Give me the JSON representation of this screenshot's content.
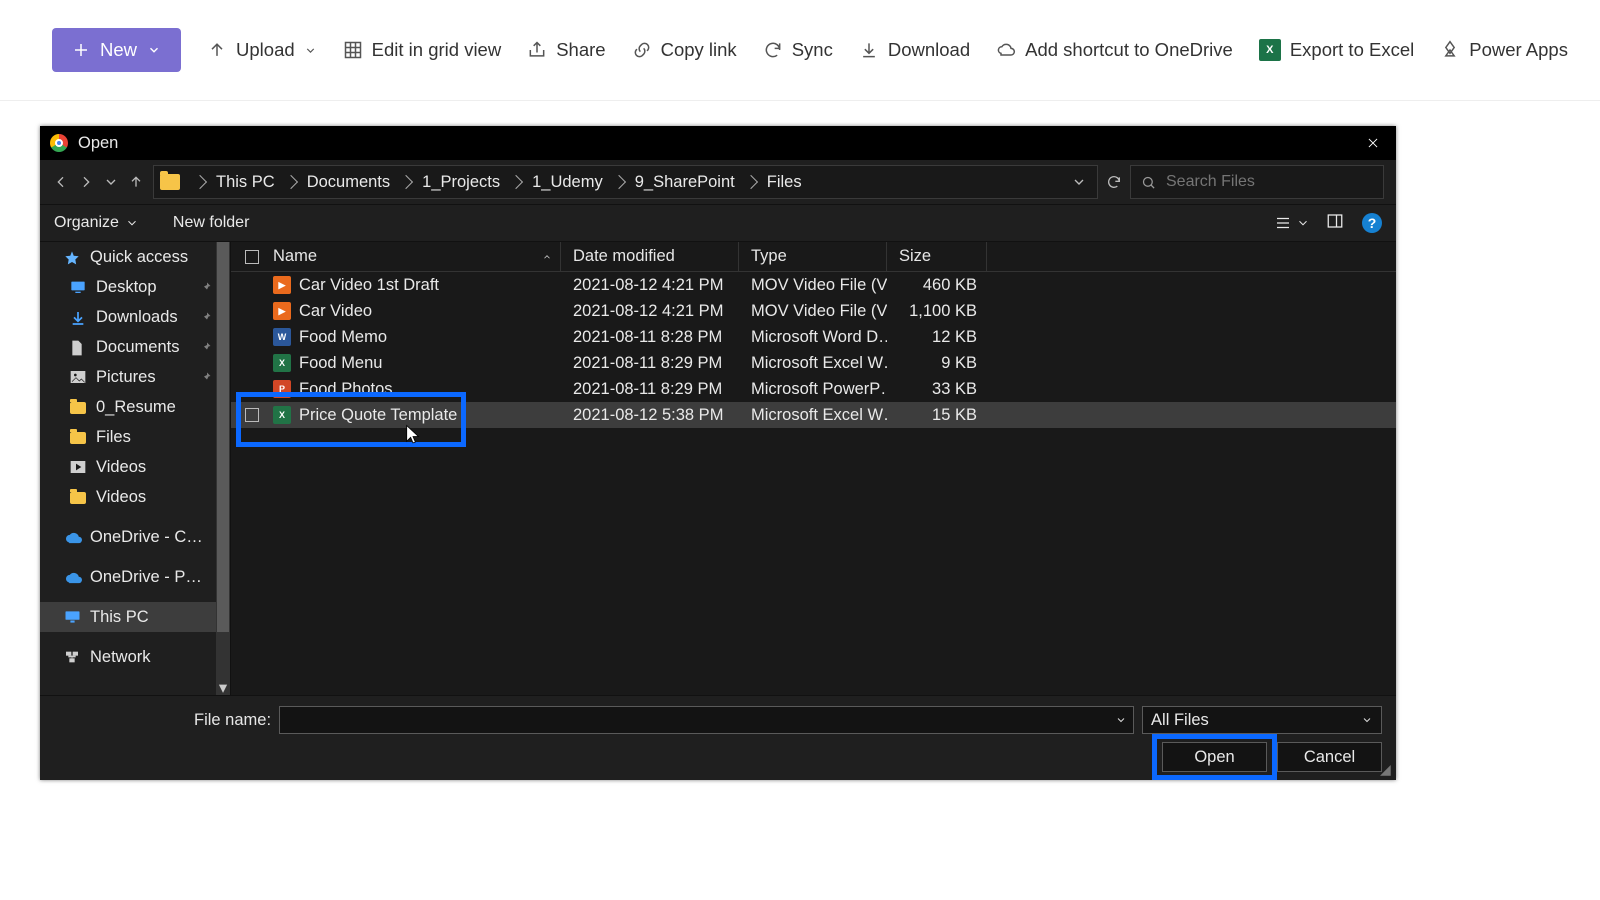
{
  "sp": {
    "new": "New",
    "upload": "Upload",
    "editgrid": "Edit in grid view",
    "share": "Share",
    "copy": "Copy link",
    "sync": "Sync",
    "download": "Download",
    "shortcut": "Add shortcut to OneDrive",
    "excel": "Export to Excel",
    "power": "Power Apps"
  },
  "dialog": {
    "title": "Open",
    "path": [
      "This PC",
      "Documents",
      "1_Projects",
      "1_Udemy",
      "9_SharePoint",
      "Files"
    ],
    "search_ph": "Search Files",
    "organize": "Organize",
    "newfolder": "New folder",
    "cols": {
      "name": "Name",
      "date": "Date modified",
      "type": "Type",
      "size": "Size"
    },
    "filename_label": "File name:",
    "filter": "All Files",
    "open": "Open",
    "cancel": "Cancel"
  },
  "nav": [
    {
      "label": "Quick access",
      "icon": "star"
    },
    {
      "label": "Desktop",
      "icon": "desktop",
      "pinned": true,
      "child": true
    },
    {
      "label": "Downloads",
      "icon": "downloads",
      "pinned": true,
      "child": true
    },
    {
      "label": "Documents",
      "icon": "documents",
      "pinned": true,
      "child": true
    },
    {
      "label": "Pictures",
      "icon": "pictures",
      "pinned": true,
      "child": true
    },
    {
      "label": "0_Resume",
      "icon": "folder",
      "child": true
    },
    {
      "label": "Files",
      "icon": "folder",
      "child": true
    },
    {
      "label": "Videos",
      "icon": "videos",
      "child": true
    },
    {
      "label": "Videos",
      "icon": "folder",
      "child": true
    },
    {
      "label": "OneDrive - Comp",
      "icon": "cloud"
    },
    {
      "label": "OneDrive - Person",
      "icon": "cloud"
    },
    {
      "label": "This PC",
      "icon": "pc",
      "selected": true
    },
    {
      "label": "Network",
      "icon": "network"
    }
  ],
  "files": [
    {
      "name": "Car Video 1st Draft",
      "date": "2021-08-12 4:21 PM",
      "type": "MOV Video File (V…",
      "size": "460 KB",
      "ic": "mov"
    },
    {
      "name": "Car Video",
      "date": "2021-08-12 4:21 PM",
      "type": "MOV Video File (V…",
      "size": "1,100 KB",
      "ic": "mov"
    },
    {
      "name": "Food Memo",
      "date": "2021-08-11 8:28 PM",
      "type": "Microsoft Word D…",
      "size": "12 KB",
      "ic": "word"
    },
    {
      "name": "Food Menu",
      "date": "2021-08-11 8:29 PM",
      "type": "Microsoft Excel W…",
      "size": "9 KB",
      "ic": "excel"
    },
    {
      "name": "Food Photos",
      "date": "2021-08-11 8:29 PM",
      "type": "Microsoft PowerP…",
      "size": "33 KB",
      "ic": "ppt"
    },
    {
      "name": "Price Quote Template",
      "date": "2021-08-12 5:38 PM",
      "type": "Microsoft Excel W…",
      "size": "15 KB",
      "ic": "excel",
      "selected": true
    }
  ]
}
